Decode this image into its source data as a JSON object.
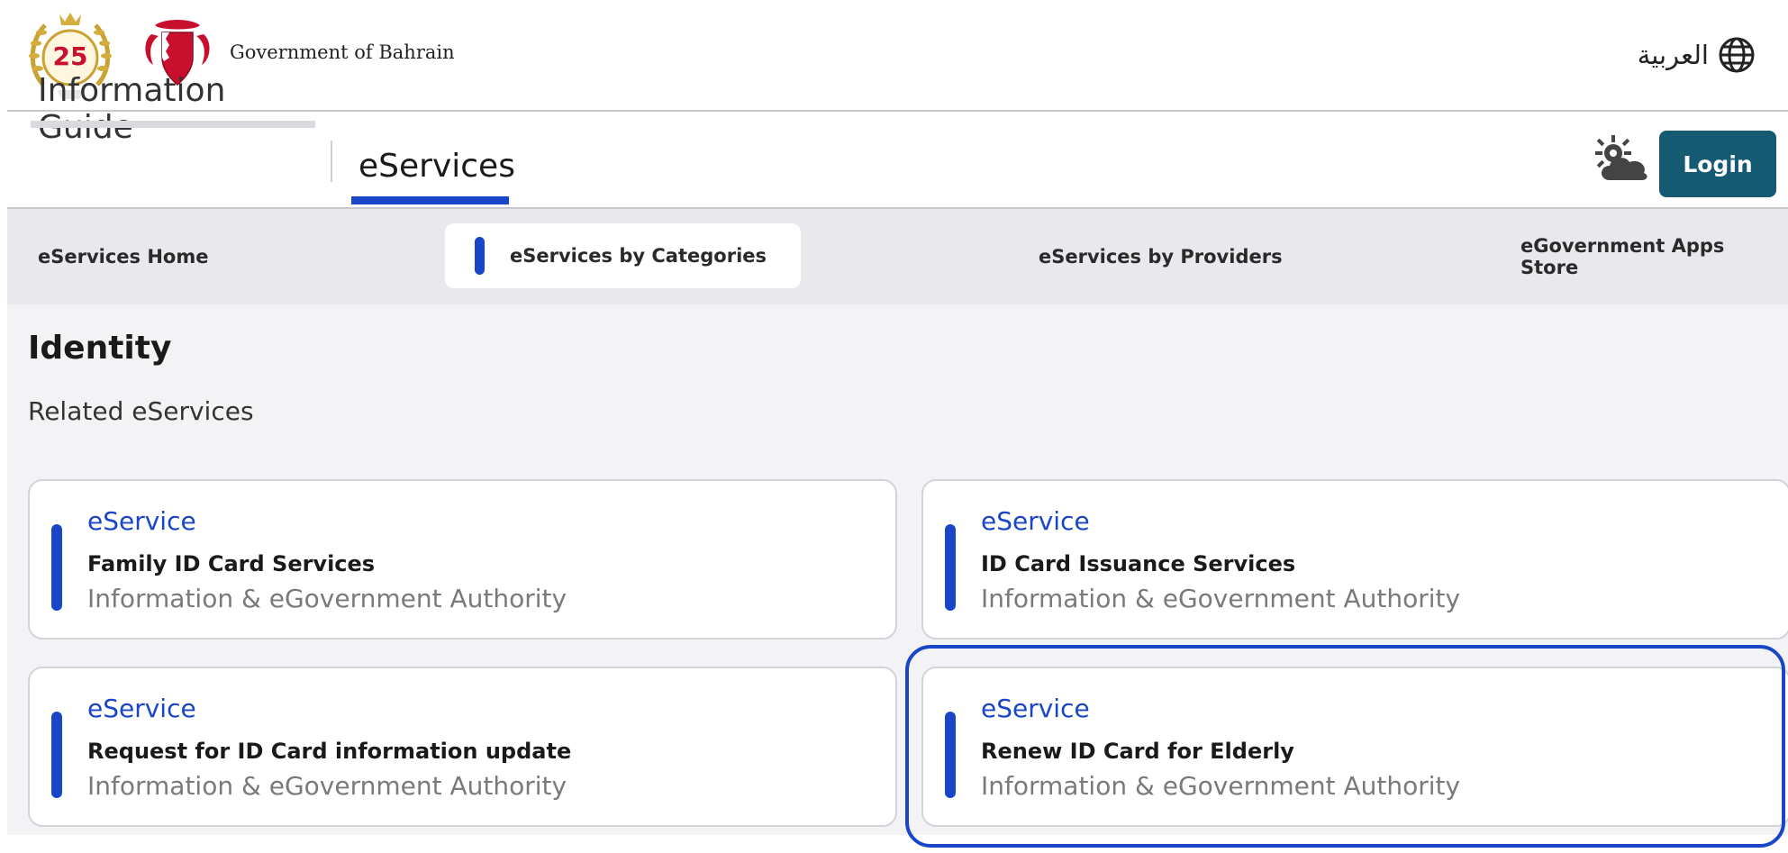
{
  "header": {
    "government_name": "Government of Bahrain",
    "language_label": "العربية",
    "emblem_number": "25"
  },
  "main_nav": {
    "tabs": [
      {
        "label": "Information Guide",
        "active": false
      },
      {
        "label": "eServices",
        "active": true
      }
    ],
    "login_label": "Login"
  },
  "sub_nav": {
    "items": [
      {
        "label": "eServices Home",
        "active": false
      },
      {
        "label": "eServices by Categories",
        "active": true
      },
      {
        "label": "eServices by Providers",
        "active": false
      },
      {
        "label": "eGovernment Apps Store",
        "active": false
      }
    ]
  },
  "page": {
    "title": "Identity",
    "subtitle": "Related eServices"
  },
  "cards": [
    {
      "kind": "eService",
      "title": "Family ID Card Services",
      "provider": "Information & eGovernment Authority"
    },
    {
      "kind": "eService",
      "title": "ID Card Issuance Services",
      "provider": "Information & eGovernment Authority"
    },
    {
      "kind": "eService",
      "title": "Request for ID Card information update",
      "provider": "Information & eGovernment Authority"
    },
    {
      "kind": "eService",
      "title": "Renew ID Card for Elderly",
      "provider": "Information & eGovernment Authority",
      "highlighted": true
    }
  ],
  "colors": {
    "accent": "#1846c7",
    "login_bg": "#145a73",
    "subnav_bg": "#e8e8ed",
    "provider_text": "#7a7a7a"
  },
  "icons": [
    "emblem-25-icon",
    "coat-of-arms-icon",
    "globe-icon",
    "weather-icon"
  ]
}
